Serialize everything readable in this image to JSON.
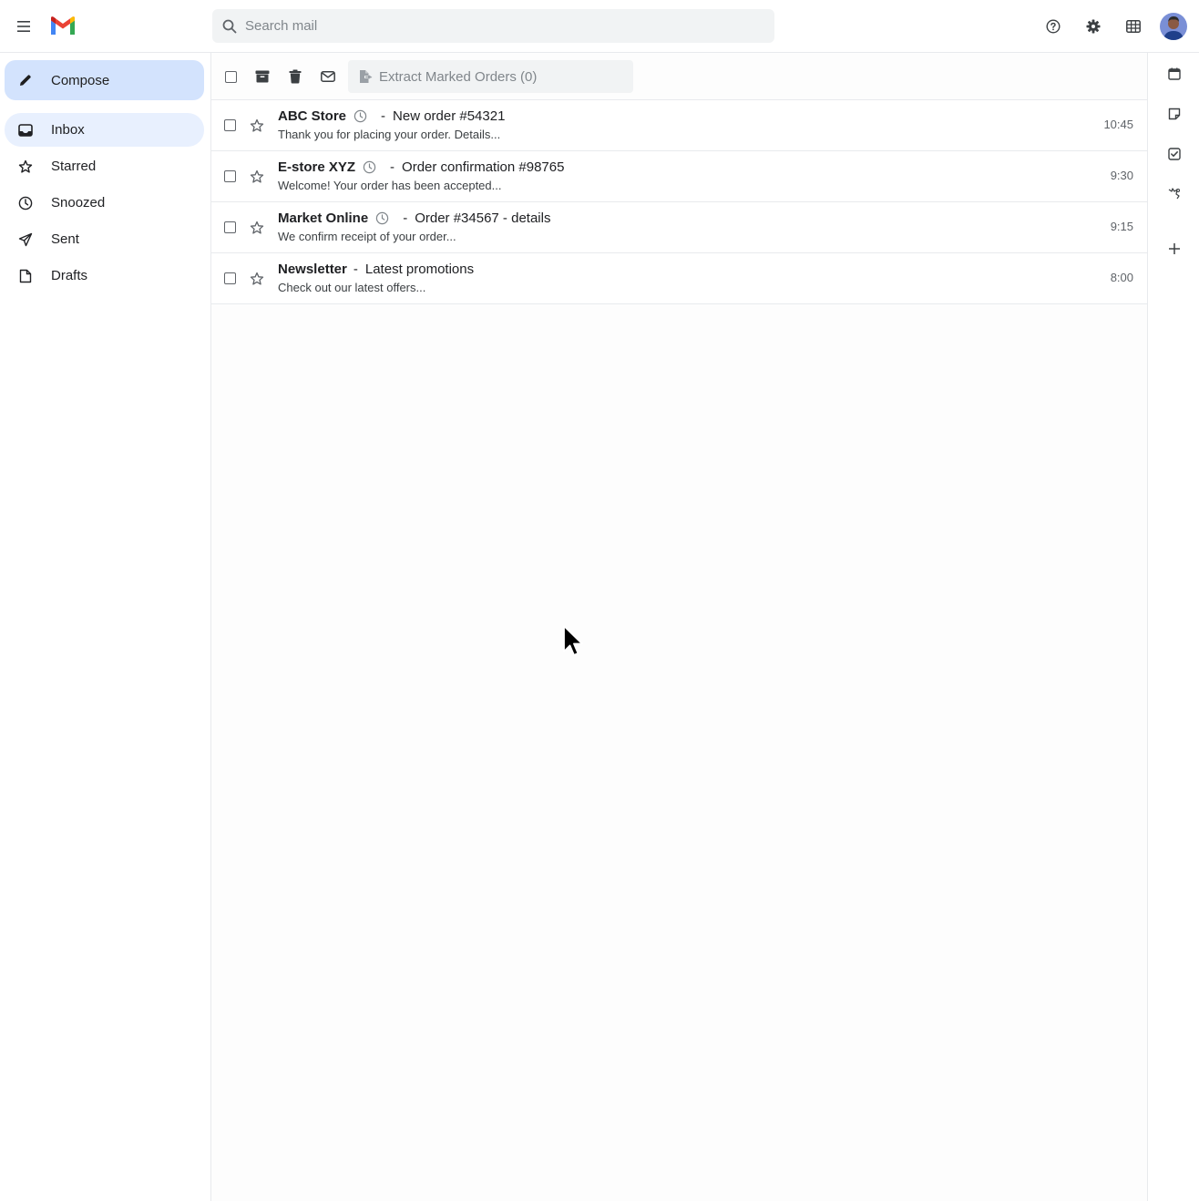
{
  "app": {
    "name": "Gmail"
  },
  "search": {
    "placeholder": "Search mail",
    "value": ""
  },
  "sidebar": {
    "compose_label": "Compose",
    "items": [
      {
        "label": "Inbox",
        "icon": "inbox-icon",
        "active": true
      },
      {
        "label": "Starred",
        "icon": "star-icon"
      },
      {
        "label": "Snoozed",
        "icon": "clock-icon"
      },
      {
        "label": "Sent",
        "icon": "send-icon"
      },
      {
        "label": "Drafts",
        "icon": "draft-icon"
      }
    ]
  },
  "toolbar": {
    "extract_label": "Extract Marked Orders (0)"
  },
  "emails": [
    {
      "sender": "ABC Store",
      "snoozed": true,
      "subject": "New order #54321",
      "snippet": "Thank you for placing your order. Details...",
      "time": "10:45"
    },
    {
      "sender": "E-store XYZ",
      "snoozed": true,
      "subject": "Order confirmation #98765",
      "snippet": "Welcome! Your order has been accepted...",
      "time": "9:30"
    },
    {
      "sender": "Market Online",
      "snoozed": true,
      "subject": "Order #34567 - details",
      "snippet": "We confirm receipt of your order...",
      "time": "9:15"
    },
    {
      "sender": "Newsletter",
      "snoozed": false,
      "subject": "Latest promotions",
      "snippet": "Check out our latest offers...",
      "time": "8:00"
    }
  ],
  "colors": {
    "compose_bg": "#d3e3fd",
    "active_nav_bg": "#e8f0fe",
    "search_bg": "#f1f3f4"
  },
  "dash": "-"
}
